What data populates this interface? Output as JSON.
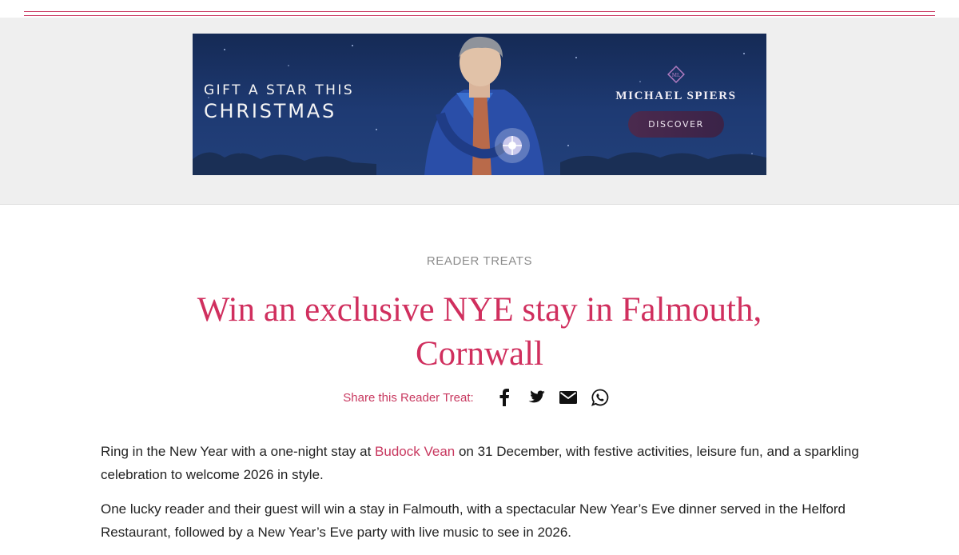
{
  "colors": {
    "accent": "#d02f5e",
    "band": "#efefef",
    "banner_bg": "#1e3a73"
  },
  "ad": {
    "line1": "GIFT A STAR THIS",
    "line2": "CHRISTMAS",
    "brand_name": "MICHAEL SPIERS",
    "cta": "DISCOVER"
  },
  "article": {
    "category": "READER TREATS",
    "title_line1": "Win an exclusive NYE stay in Falmouth,",
    "title_line2": "Cornwall",
    "share_label": "Share this Reader Treat:",
    "share_icons": [
      "facebook-icon",
      "twitter-icon",
      "email-icon",
      "whatsapp-icon"
    ],
    "para1_before": "Ring in the New Year with a one-night stay at ",
    "para1_link": "Budock Vean",
    "para1_after": " on 31 December, with festive activities, leisure fun, and a sparkling celebration to welcome 2026 in style.",
    "para2": "One lucky reader and their guest will win a stay in Falmouth, with a spectacular New Year’s Eve dinner served in the Helford Restaurant, followed by a New Year’s Eve party with live music to see in 2026."
  }
}
